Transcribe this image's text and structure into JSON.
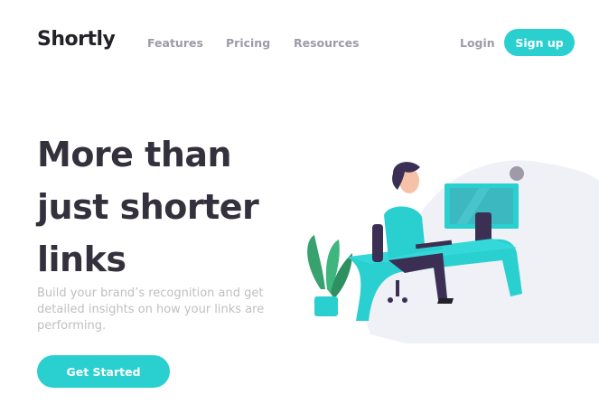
{
  "header": {
    "logo": "Shortly",
    "nav": {
      "features": "Features",
      "pricing": "Pricing",
      "resources": "Resources"
    },
    "login": "Login",
    "signup": "Sign up"
  },
  "hero": {
    "headline_lines": [
      "More than",
      "just shorter",
      "links"
    ],
    "subtext": "Build your brand’s recognition and get detailed insights on how your links are performing.",
    "cta": "Get Started"
  },
  "colors": {
    "accent": "#2acfcf",
    "heading": "#34313d",
    "nav_text": "#9e9aa8",
    "body_text": "#bfbfbf"
  },
  "illustration": {
    "icon": "person-working-at-desk-illustration"
  }
}
